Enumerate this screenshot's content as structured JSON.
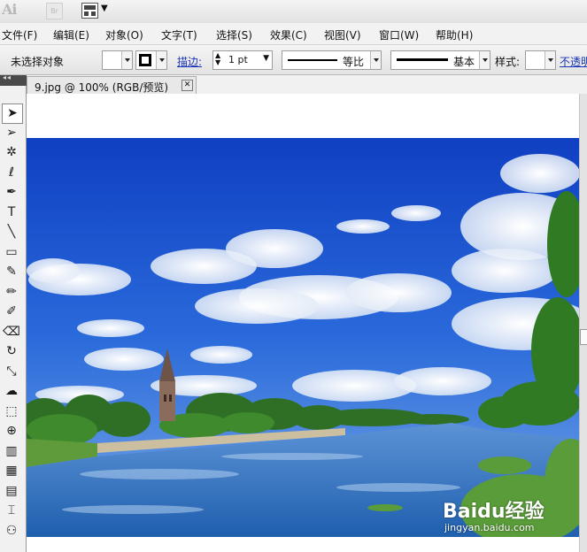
{
  "app": {
    "logo": "Ai",
    "bridge_label": "Br"
  },
  "menu": [
    {
      "label": "文件(F)"
    },
    {
      "label": "编辑(E)"
    },
    {
      "label": "对象(O)"
    },
    {
      "label": "文字(T)"
    },
    {
      "label": "选择(S)"
    },
    {
      "label": "效果(C)"
    },
    {
      "label": "视图(V)"
    },
    {
      "label": "窗口(W)"
    },
    {
      "label": "帮助(H)"
    }
  ],
  "control": {
    "selection_status": "未选择对象",
    "stroke_label": "描边:",
    "stroke_weight": "1 pt",
    "variable_width": "等比",
    "brush": "基本",
    "style_label": "样式:",
    "opacity_label": "不透明"
  },
  "document": {
    "tab_title": "9.jpg @ 100% (RGB/预览)",
    "close_glyph": "✕"
  },
  "watermark": {
    "main": "Baidu经验",
    "sub": "jingyan.baidu.com"
  },
  "tools": [
    {
      "name": "selection-tool",
      "glyph": "➤"
    },
    {
      "name": "direct-selection-tool",
      "glyph": "➢"
    },
    {
      "name": "magic-wand-tool",
      "glyph": "✲"
    },
    {
      "name": "lasso-tool",
      "glyph": "ℓ"
    },
    {
      "name": "pen-tool",
      "glyph": "✒"
    },
    {
      "name": "type-tool",
      "glyph": "T"
    },
    {
      "name": "line-tool",
      "glyph": "╲"
    },
    {
      "name": "rectangle-tool",
      "glyph": "▭"
    },
    {
      "name": "paintbrush-tool",
      "glyph": "✎"
    },
    {
      "name": "pencil-tool",
      "glyph": "✏"
    },
    {
      "name": "blob-brush-tool",
      "glyph": "✐"
    },
    {
      "name": "eraser-tool",
      "glyph": "⌫"
    },
    {
      "name": "rotate-tool",
      "glyph": "↻"
    },
    {
      "name": "scale-tool",
      "glyph": "⤡"
    },
    {
      "name": "warp-tool",
      "glyph": "☁"
    },
    {
      "name": "free-transform-tool",
      "glyph": "⬚"
    },
    {
      "name": "shape-builder-tool",
      "glyph": "⊕"
    },
    {
      "name": "graph-tool",
      "glyph": "▥"
    },
    {
      "name": "mesh-tool",
      "glyph": "▦"
    },
    {
      "name": "gradient-tool",
      "glyph": "▤"
    },
    {
      "name": "eyedropper-tool",
      "glyph": "⌶"
    },
    {
      "name": "blend-tool",
      "glyph": "⚇"
    }
  ],
  "colors": {
    "sky_top": "#1446c4",
    "sky_bottom": "#5d98e4",
    "water": "#2a6fc0",
    "link_blue": "#1a35b8"
  }
}
